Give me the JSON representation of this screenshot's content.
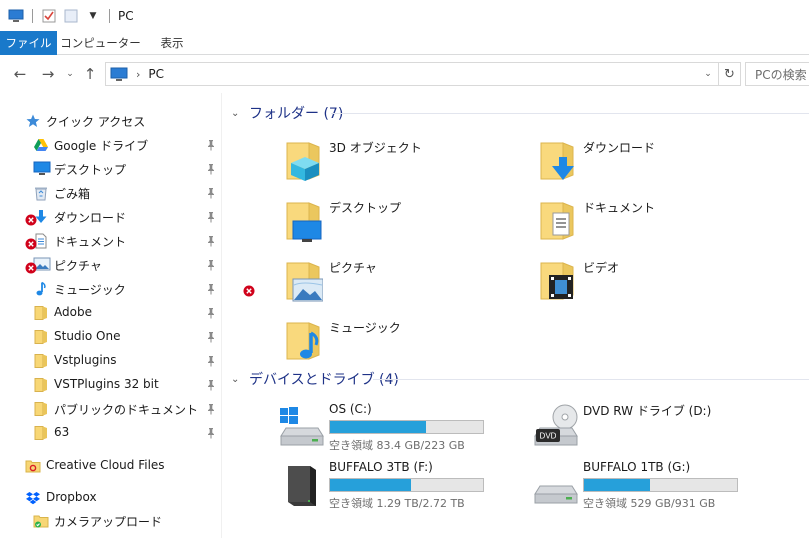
{
  "window": {
    "title": "PC"
  },
  "ribbon": {
    "tabs": [
      "ファイル",
      "コンピューター",
      "表示"
    ]
  },
  "address": {
    "path": "PC",
    "search_placeholder": "PCの検索"
  },
  "nav": {
    "quick_access": "クイック アクセス",
    "items": [
      {
        "label": "Google ドライブ",
        "icon": "google-drive-icon",
        "pinned": true,
        "error": false
      },
      {
        "label": "デスクトップ",
        "icon": "desktop-icon",
        "pinned": true,
        "error": false
      },
      {
        "label": "ごみ箱",
        "icon": "recycle-bin-icon",
        "pinned": true,
        "error": false
      },
      {
        "label": "ダウンロード",
        "icon": "download-icon",
        "pinned": true,
        "error": true
      },
      {
        "label": "ドキュメント",
        "icon": "document-icon",
        "pinned": true,
        "error": true
      },
      {
        "label": "ピクチャ",
        "icon": "picture-icon",
        "pinned": true,
        "error": true
      },
      {
        "label": "ミュージック",
        "icon": "music-icon",
        "pinned": true,
        "error": false
      },
      {
        "label": "Adobe",
        "icon": "folder-icon",
        "pinned": true,
        "error": false
      },
      {
        "label": "Studio One",
        "icon": "folder-icon",
        "pinned": true,
        "error": false
      },
      {
        "label": "Vstplugins",
        "icon": "folder-icon",
        "pinned": true,
        "error": false
      },
      {
        "label": "VSTPlugins 32 bit",
        "icon": "folder-icon",
        "pinned": true,
        "error": false
      },
      {
        "label": "パブリックのドキュメント",
        "icon": "folder-icon",
        "pinned": true,
        "error": false
      },
      {
        "label": "63",
        "icon": "folder-icon",
        "pinned": true,
        "error": false
      }
    ],
    "creative_cloud": "Creative Cloud Files",
    "dropbox": "Dropbox",
    "dropbox_child": "カメラアップロード"
  },
  "folders_group": {
    "header": "フォルダー (7)"
  },
  "folders": [
    {
      "name": "3D オブジェクト",
      "icon": "3d-objects-icon",
      "error": false
    },
    {
      "name": "ダウンロード",
      "icon": "download-folder-icon",
      "error": false
    },
    {
      "name": "デスクトップ",
      "icon": "desktop-folder-icon",
      "error": false
    },
    {
      "name": "ドキュメント",
      "icon": "documents-folder-icon",
      "error": false
    },
    {
      "name": "ピクチャ",
      "icon": "pictures-folder-icon",
      "error": true
    },
    {
      "name": "ビデオ",
      "icon": "videos-folder-icon",
      "error": false
    },
    {
      "name": "ミュージック",
      "icon": "music-folder-icon",
      "error": false
    }
  ],
  "drives_group": {
    "header": "デバイスとドライブ (4)"
  },
  "drives": [
    {
      "name": "OS (C:)",
      "free": "空き領域 83.4 GB/223 GB",
      "used_fraction": 0.63,
      "icon": "windows-drive-icon"
    },
    {
      "name": "DVD RW ドライブ (D:)",
      "free": "",
      "used_fraction": null,
      "icon": "dvd-drive-icon"
    },
    {
      "name": "BUFFALO 3TB (F:)",
      "free": "空き領域 1.29 TB/2.72 TB",
      "used_fraction": 0.53,
      "icon": "external-hdd-icon"
    },
    {
      "name": "BUFFALO 1TB (G:)",
      "free": "空き領域 529 GB/931 GB",
      "used_fraction": 0.43,
      "icon": "usb-drive-icon"
    }
  ],
  "colors": {
    "accent": "#1979ca",
    "bar_fill": "#26a0da",
    "group_header": "#1e3287",
    "error": "#d0021b"
  }
}
